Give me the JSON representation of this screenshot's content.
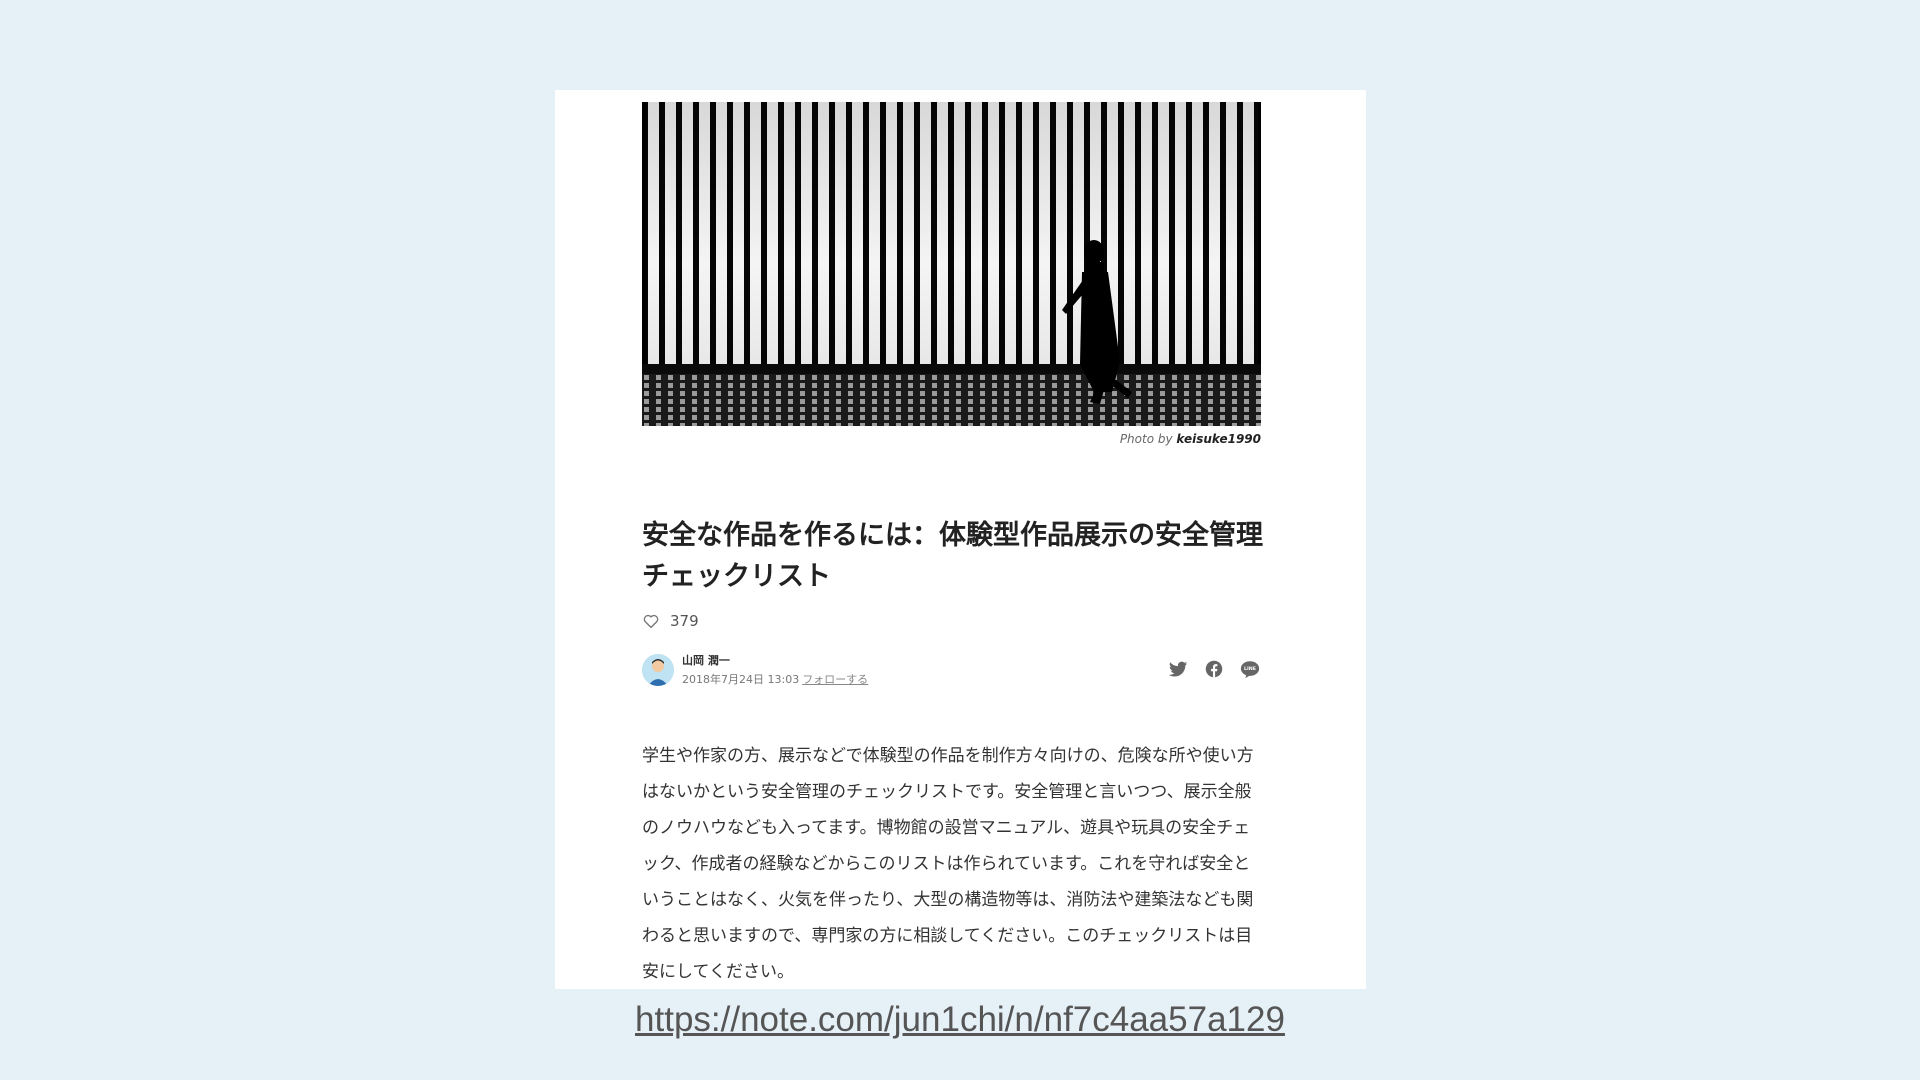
{
  "hero": {
    "credit_prefix": "Photo by",
    "credit_author": "keisuke1990"
  },
  "article": {
    "title": "安全な作品を作るには：体験型作品展示の安全管理チェックリスト",
    "likes": "379",
    "author_name": "山岡 潤一",
    "date": "2018年7月24日 13:03",
    "follow_label": "フォローする",
    "body": "学生や作家の方、展示などで体験型の作品を制作方々向けの、危険な所や使い方はないかという安全管理のチェックリストです。安全管理と言いつつ、展示全般のノウハウなども入ってます。博物館の設営マニュアル、遊具や玩具の安全チェック、作成者の経験などからこのリストは作られています。これを守れば安全ということはなく、火気を伴ったり、大型の構造物等は、消防法や建築法なども関わると思いますので、専門家の方に相談してください。このチェックリストは目安にしてください。"
  },
  "share": {
    "icons": [
      "twitter-icon",
      "facebook-icon",
      "line-icon"
    ],
    "line_text": "LINE"
  },
  "footer": {
    "url": "https://note.com/jun1chi/n/nf7c4aa57a129"
  },
  "colors": {
    "background": "#e6f0f7",
    "card": "#ffffff",
    "text": "#222222"
  }
}
